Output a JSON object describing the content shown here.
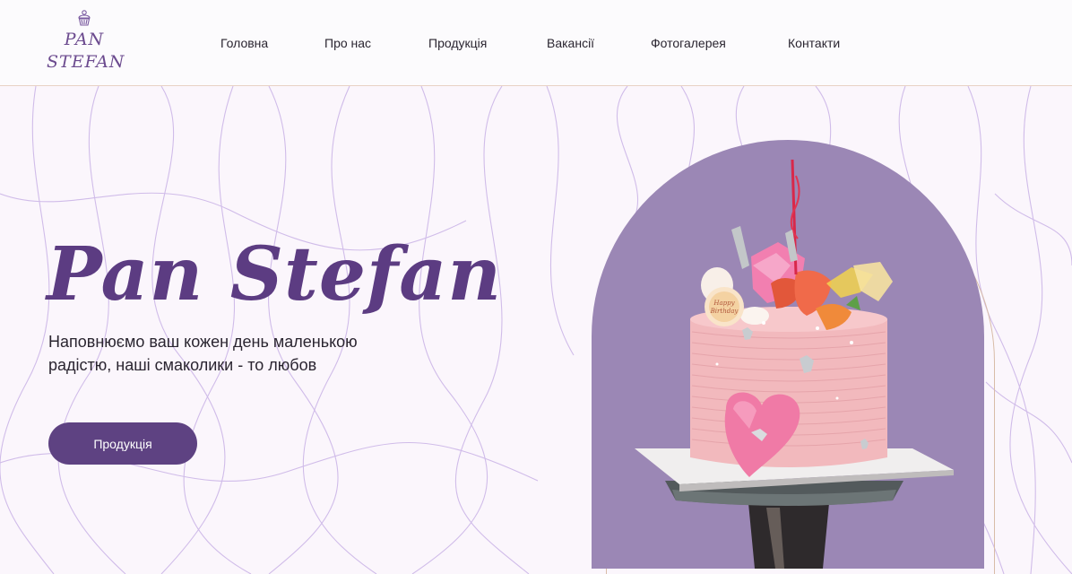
{
  "logo": {
    "line1": "PAN",
    "line2": "STEFAN",
    "icon": "cupcake-icon"
  },
  "nav": {
    "items": [
      {
        "label": "Головна"
      },
      {
        "label": "Про нас"
      },
      {
        "label": "Продукція"
      },
      {
        "label": "Вакансії"
      },
      {
        "label": "Фотогалерея"
      },
      {
        "label": "Контакти"
      }
    ]
  },
  "hero": {
    "title": "Pan Stefan",
    "subtitle_line1": "Наповнюємо ваш кожен день маленькою",
    "subtitle_line2": "радістю, наші смаколики - то любов",
    "button_label": "Продукція"
  },
  "image": {
    "cake_topper_text": "Happy Birthday"
  },
  "colors": {
    "brand_purple": "#5e4282",
    "arch_purple": "#9b87b5",
    "background": "#fbf6fc",
    "cake_pink": "#f0b7bd"
  }
}
